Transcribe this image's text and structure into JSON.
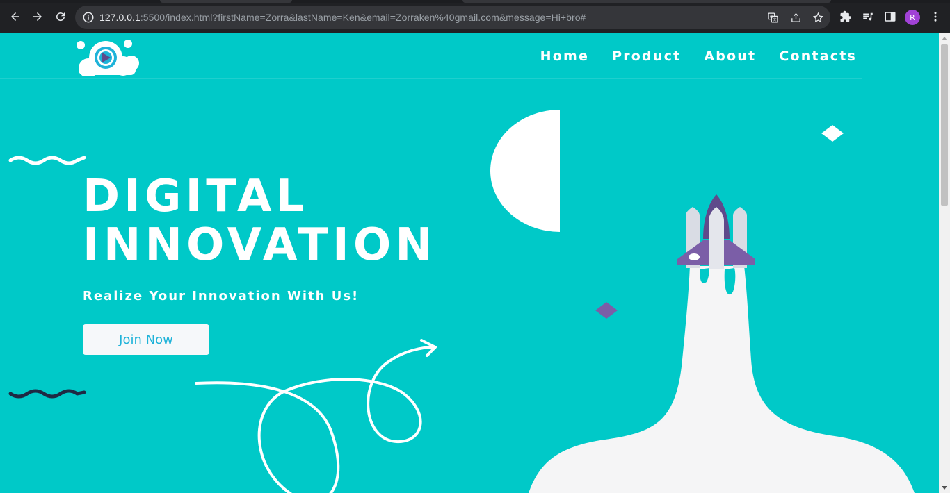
{
  "browser": {
    "url_host": "127.0.0.1",
    "url_rest": ":5500/index.html?firstName=Zorra&lastName=Ken&email=Zorraken%40gmail.com&message=Hi+bro#",
    "profile_initial": "R"
  },
  "nav": {
    "items": [
      "Home",
      "Product",
      "About",
      "Contacts"
    ]
  },
  "hero": {
    "title_line1": "DIGITAL",
    "title_line2": "INNOVATION",
    "subtitle": "Realize Your Innovation With Us!",
    "cta_label": "Join Now"
  },
  "colors": {
    "background": "#00c9c8",
    "accent_purple": "#7b5ea7",
    "button_text": "#1fb3d9",
    "dark_wave": "#1e2a44"
  },
  "icons": [
    "back-icon",
    "forward-icon",
    "reload-icon",
    "info-icon",
    "translate-icon",
    "share-icon",
    "bookmark-star-icon",
    "extensions-icon",
    "media-icon",
    "side-panel-icon",
    "menu-icon",
    "logo-icon",
    "rocket-icon"
  ]
}
